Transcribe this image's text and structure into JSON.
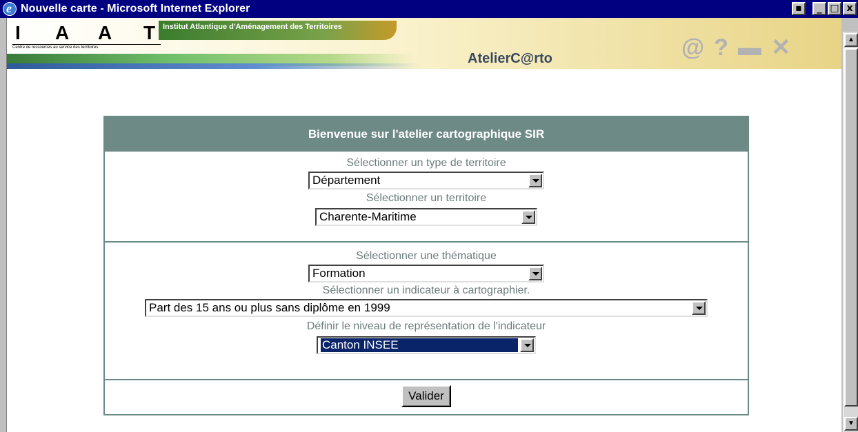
{
  "window": {
    "title": "Nouvelle carte - Microsoft Internet Explorer",
    "buttons": {
      "minimize": "_",
      "maximize": "□",
      "close": "x"
    }
  },
  "banner": {
    "logo_letters": [
      "I",
      "A",
      "A",
      "T"
    ],
    "logo_subtitle": "Centre de ressources au service des territoires",
    "institut": "Institut Atlantique d'Aménagement des Territoires",
    "app_name": "AtelierC@rto",
    "tools": {
      "contact": "@",
      "help": "?",
      "print": "▬",
      "close": "✕"
    }
  },
  "form": {
    "header": "Bienvenue sur l'atelier cartographique SIR",
    "territory": {
      "type_label": "Sélectionner un type de territoire",
      "type_value": "Département",
      "territory_label": "Sélectionner un territoire",
      "territory_value": "Charente-Maritime"
    },
    "theme": {
      "theme_label": "Sélectionner une thématique",
      "theme_value": "Formation",
      "indicator_label": "Sélectionner un indicateur à cartographier.",
      "indicator_value": "Part des 15 ans ou plus sans diplôme en 1999",
      "level_label": "Définir le niveau de représentation de l'indicateur",
      "level_value": "Canton INSEE"
    },
    "submit_label": "Valider"
  }
}
